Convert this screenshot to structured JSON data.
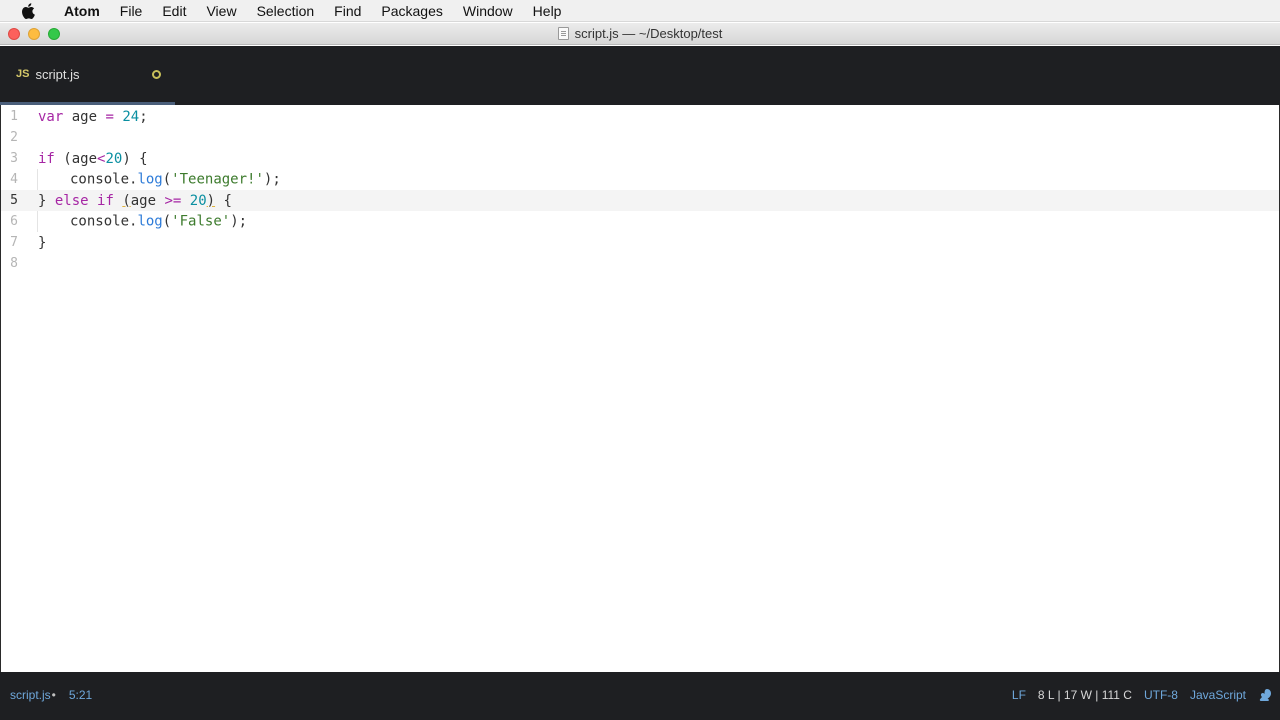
{
  "menubar": {
    "app": "Atom",
    "items": [
      "File",
      "Edit",
      "View",
      "Selection",
      "Find",
      "Packages",
      "Window",
      "Help"
    ]
  },
  "window": {
    "title": "script.js — ~/Desktop/test"
  },
  "tab": {
    "badge": "JS",
    "name": "script.js"
  },
  "editor": {
    "current_line": 5,
    "line_numbers": [
      "1",
      "2",
      "3",
      "4",
      "5",
      "6",
      "7",
      "8"
    ]
  },
  "status": {
    "file": "script.js",
    "cursor": "5:21",
    "line_ending": "LF",
    "counts": "8 L | 17 W | 111 C",
    "encoding": "UTF-8",
    "grammar": "JavaScript"
  },
  "colors": {
    "keyword": "#a626a4",
    "number": "#0a8fa1",
    "string": "#3d7b2d",
    "function": "#2d7bd8"
  }
}
